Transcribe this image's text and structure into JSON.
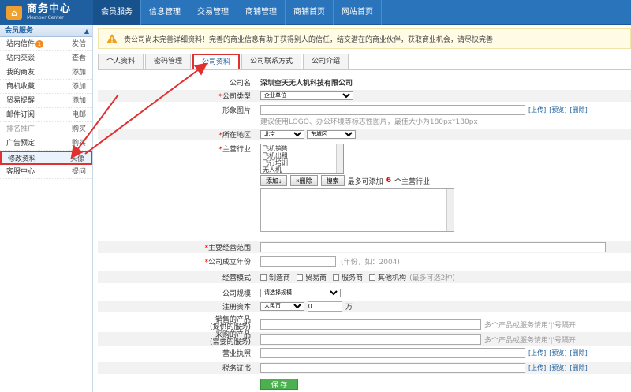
{
  "header": {
    "logo_title": "商务中心",
    "logo_sub": "Member Center",
    "nav": [
      "会员服务",
      "信息管理",
      "交易管理",
      "商铺管理",
      "商铺首页",
      "网站首页"
    ]
  },
  "sidebar": {
    "title": "会员服务",
    "items": [
      {
        "left": "站内信件",
        "right": "发信",
        "badge": "1"
      },
      {
        "left": "站内交谈",
        "right": "查看"
      },
      {
        "left": "我的商友",
        "right": "添加"
      },
      {
        "left": "商机收藏",
        "right": "添加"
      },
      {
        "left": "贸易提醒",
        "right": "添加"
      },
      {
        "left": "邮件订阅",
        "right": "电邮"
      },
      {
        "left": "排名推广",
        "right": "购买"
      },
      {
        "left": "广告预定",
        "right": "购买"
      },
      {
        "left": "修改资料",
        "right": "头像"
      },
      {
        "left": "客服中心",
        "right": "提问"
      }
    ]
  },
  "notice": "贵公司尚未完善详细资料！完善的商业信息有助于获得别人的信任，结交潜在的商业伙伴，获取商业机会，请尽快完善",
  "tabs": [
    "个人资料",
    "密码管理",
    "公司资料",
    "公司联系方式",
    "公司介绍"
  ],
  "form": {
    "company_name_label": "公司名",
    "company_name": "深圳空天无人机科技有限公司",
    "company_type_label": "公司类型",
    "company_type": "企业单位",
    "image_label": "形象图片",
    "image_hint": "建议使用LOGO、办公环境等标志性图片，最佳大小为180px*180px",
    "upload": "[上传]",
    "preview": "[预览]",
    "delete": "[删除]",
    "region_label": "所在地区",
    "region_city": "北京",
    "region_district": "东城区",
    "industry_label": "主营行业",
    "industry_options": [
      "飞机销售",
      "飞机出租",
      "飞行培训",
      "无人机"
    ],
    "add_btn": "添加↓",
    "remove_btn": "×删除",
    "search_btn": "搜索",
    "industry_hint_pre": "最多可添加",
    "industry_hint_num": "6",
    "industry_hint_post": "个主营行业",
    "business_scope_label": "主要经营范围",
    "founded_label": "公司成立年份",
    "founded_hint": "(年份，如：2004)",
    "mode_label": "经营模式",
    "modes": [
      "制造商",
      "贸易商",
      "服务商",
      "其他机构"
    ],
    "mode_hint": "(最多可选2种)",
    "scale_label": "公司规模",
    "scale": "请选择规模",
    "capital_label": "注册资本",
    "currency": "人民币",
    "capital": "0",
    "capital_unit": "万",
    "sell_label_1": "销售的产品",
    "sell_label_2": "(提供的服务)",
    "buy_label_1": "采购的产品",
    "buy_label_2": "(需要的服务)",
    "multi_hint": "多个产品或服务请用'|'号隔开",
    "license_label": "营业执照",
    "cert_label": "税务证书",
    "save": "保 存"
  },
  "colors": {
    "brand": "#2a74bb",
    "highlight": "#e03030",
    "save": "#4caf50"
  }
}
